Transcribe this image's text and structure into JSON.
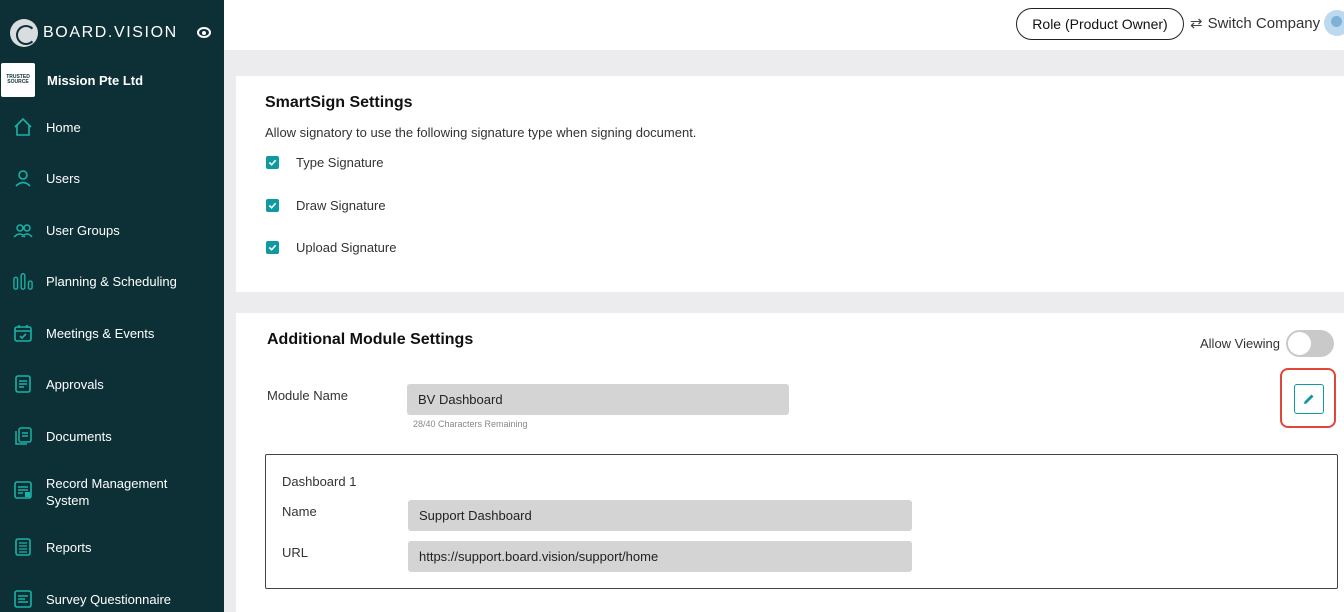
{
  "brand": {
    "name": "BOARD.VISION"
  },
  "company": {
    "name": "Mission Pte Ltd",
    "logo_text": "TRUSTED SOURCE"
  },
  "sidebar": {
    "items": [
      {
        "label": "Home",
        "icon": "home-icon"
      },
      {
        "label": "Users",
        "icon": "user-icon"
      },
      {
        "label": "User Groups",
        "icon": "user-group-icon"
      },
      {
        "label": "Planning & Scheduling",
        "icon": "bar-chart-icon"
      },
      {
        "label": "Meetings & Events",
        "icon": "calendar-icon"
      },
      {
        "label": "Approvals",
        "icon": "approvals-icon"
      },
      {
        "label": "Documents",
        "icon": "documents-icon"
      },
      {
        "label": "Record Management System",
        "icon": "record-icon"
      },
      {
        "label": "Reports",
        "icon": "reports-icon"
      },
      {
        "label": "Survey Questionnaire",
        "icon": "survey-icon"
      }
    ]
  },
  "header": {
    "role_button": "Role (Product Owner)",
    "switch_company": "Switch Company"
  },
  "smartsign": {
    "title": "SmartSign Settings",
    "description": "Allow signatory to use the following signature type when signing document.",
    "options": [
      {
        "label": "Type Signature",
        "checked": true
      },
      {
        "label": "Draw Signature",
        "checked": true
      },
      {
        "label": "Upload Signature",
        "checked": true
      }
    ]
  },
  "module": {
    "title": "Additional Module Settings",
    "toggle_label": "Allow Viewing",
    "toggle_on": false,
    "name_label": "Module Name",
    "name_value": "BV Dashboard",
    "counter": "28/40 Characters Remaining",
    "dashboard": {
      "title": "Dashboard 1",
      "name_label": "Name",
      "name_value": "Support Dashboard",
      "url_label": "URL",
      "url_value": "https://support.board.vision/support/home"
    }
  },
  "colors": {
    "sidebar_bg": "#0d3036",
    "accent": "#0e9aa0",
    "highlight": "#e0473a"
  }
}
